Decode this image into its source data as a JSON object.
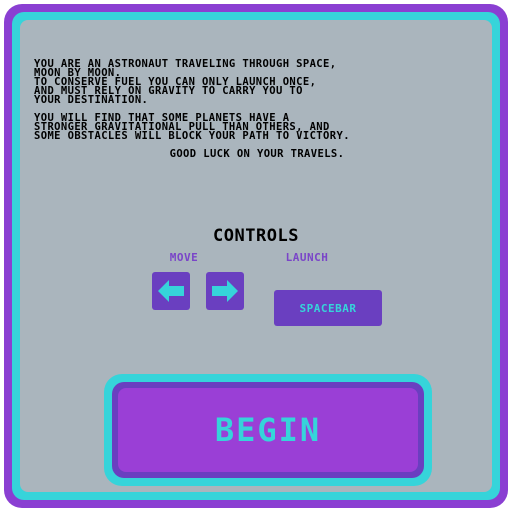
{
  "intro": {
    "paragraph1": "YOU ARE AN ASTRONAUT TRAVELING THROUGH SPACE,\nMOON BY MOON.\nTO CONSERVE FUEL YOU CAN ONLY LAUNCH ONCE,\nAND MUST RELY ON GRAVITY TO CARRY YOU TO\nYOUR DESTINATION.",
    "paragraph2": "YOU WILL FIND THAT SOME PLANETS HAVE A\nSTRONGER GRAVITATIONAL PULL THAN OTHERS, AND\nSOME OBSTACLES WILL BLOCK YOUR PATH TO VICTORY.",
    "good_luck": "GOOD LUCK ON YOUR TRAVELS."
  },
  "controls": {
    "title": "CONTROLS",
    "move_label": "MOVE",
    "launch_label": "LAUNCH",
    "left_key_icon": "arrow-left-icon",
    "right_key_icon": "arrow-right-icon",
    "launch_key": "SPACEBAR"
  },
  "begin_button": {
    "label": "BEGIN"
  },
  "colors": {
    "frame_purple": "#8a3fd2",
    "border_cyan": "#36d4da",
    "panel_gray": "#aab5bd",
    "key_purple": "#6a3fc0",
    "button_purple": "#9a3fd6"
  }
}
